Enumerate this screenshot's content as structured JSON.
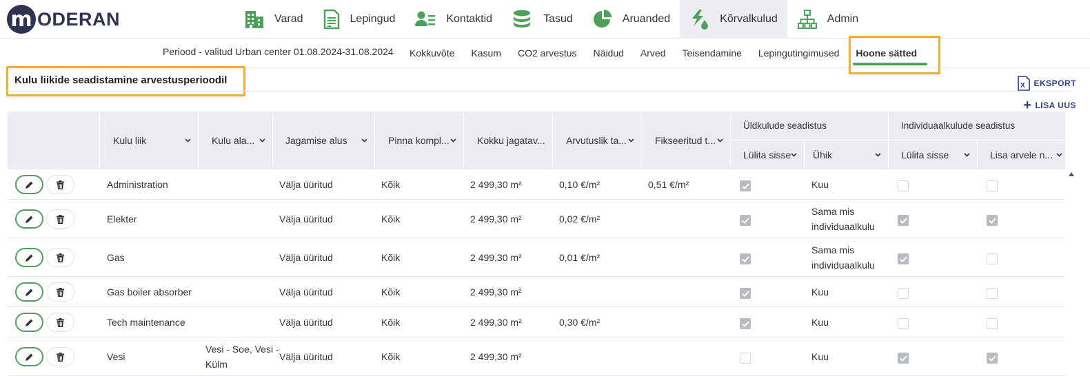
{
  "logo": {
    "mark": "m",
    "text": "ODERAN"
  },
  "main_nav": [
    {
      "label": "Varad",
      "icon": "building-icon",
      "active": false
    },
    {
      "label": "Lepingud",
      "icon": "document-icon",
      "active": false
    },
    {
      "label": "Kontaktid",
      "icon": "contacts-icon",
      "active": false
    },
    {
      "label": "Tasud",
      "icon": "coins-icon",
      "active": false
    },
    {
      "label": "Aruanded",
      "icon": "pie-chart-icon",
      "active": false
    },
    {
      "label": "Kõrvalkulud",
      "icon": "utilities-icon",
      "active": true
    },
    {
      "label": "Admin",
      "icon": "org-chart-icon",
      "active": false
    }
  ],
  "sub_nav": {
    "period": "Periood - valitud Urban center 01.08.2024-31.08.2024",
    "items": [
      {
        "label": "Kokkuvõte",
        "active": false
      },
      {
        "label": "Kasum",
        "active": false
      },
      {
        "label": "CO2 arvestus",
        "active": false
      },
      {
        "label": "Näidud",
        "active": false
      },
      {
        "label": "Arved",
        "active": false
      },
      {
        "label": "Teisendamine",
        "active": false
      },
      {
        "label": "Lepingutingimused",
        "active": false
      },
      {
        "label": "Hoone sätted",
        "active": true
      }
    ]
  },
  "section": {
    "title": "Kulu liikide seadistamine arvestusperioodil",
    "export_label": "EKSPORT",
    "add_label": "LISA UUS"
  },
  "table": {
    "headers": {
      "kulu_liik": "Kulu liik",
      "kulu_ala": "Kulu ala...",
      "jagamise_alus": "Jagamise alus",
      "pinna": "Pinna kompl...",
      "kokku": "Kokku jagatav...",
      "arvutuslik": "Arvutuslik ta...",
      "fikseeritud": "Fikseeritud t...",
      "group_general": "Üldkulude seadistus",
      "group_individual": "Individuaalkulude seadistus",
      "gen_enable": "Lülita sisse",
      "gen_unit": "Ühik",
      "ind_enable": "Lülita sisse",
      "ind_add": "Lisa arvele n..."
    },
    "rows": [
      {
        "kulu_liik": "Administration",
        "kulu_ala": "",
        "jagamise_alus": "Välja üüritud",
        "pinna": "Kõik",
        "kokku": "2 499,30 m²",
        "arvutuslik": "0,10 €/m²",
        "fikseeritud": "0,51 €/m²",
        "gen_enable": true,
        "gen_unit": "Kuu",
        "ind_enable": false,
        "ind_add": false
      },
      {
        "kulu_liik": "Elekter",
        "kulu_ala": "",
        "jagamise_alus": "Välja üüritud",
        "pinna": "Kõik",
        "kokku": "2 499,30 m²",
        "arvutuslik": "0,02 €/m²",
        "fikseeritud": "",
        "gen_enable": true,
        "gen_unit": "Sama mis individuaalkulu",
        "ind_enable": true,
        "ind_add": true
      },
      {
        "kulu_liik": "Gas",
        "kulu_ala": "",
        "jagamise_alus": "Välja üüritud",
        "pinna": "Kõik",
        "kokku": "2 499,30 m²",
        "arvutuslik": "0,01 €/m²",
        "fikseeritud": "",
        "gen_enable": true,
        "gen_unit": "Sama mis individuaalkulu",
        "ind_enable": true,
        "ind_add": false
      },
      {
        "kulu_liik": "Gas boiler absorber",
        "kulu_ala": "",
        "jagamise_alus": "Välja üüritud",
        "pinna": "Kõik",
        "kokku": "2 499,30 m²",
        "arvutuslik": "",
        "fikseeritud": "",
        "gen_enable": true,
        "gen_unit": "Kuu",
        "ind_enable": false,
        "ind_add": false
      },
      {
        "kulu_liik": "Tech maintenance",
        "kulu_ala": "",
        "jagamise_alus": "Välja üüritud",
        "pinna": "Kõik",
        "kokku": "2 499,30 m²",
        "arvutuslik": "0,30 €/m²",
        "fikseeritud": "",
        "gen_enable": true,
        "gen_unit": "Kuu",
        "ind_enable": false,
        "ind_add": false
      },
      {
        "kulu_liik": "Vesi",
        "kulu_ala": "Vesi - Soe, Vesi - Külm",
        "jagamise_alus": "Välja üüritud",
        "pinna": "Kõik",
        "kokku": "2 499,30 m²",
        "arvutuslik": "",
        "fikseeritud": "",
        "gen_enable": false,
        "gen_unit": "Kuu",
        "ind_enable": true,
        "ind_add": true
      }
    ]
  },
  "colors": {
    "brand": "#2f3350",
    "accent_green": "#4fa05a",
    "link_blue": "#2d3a8c",
    "highlight": "#f4ae2e",
    "header_bg": "#eaecf2"
  }
}
